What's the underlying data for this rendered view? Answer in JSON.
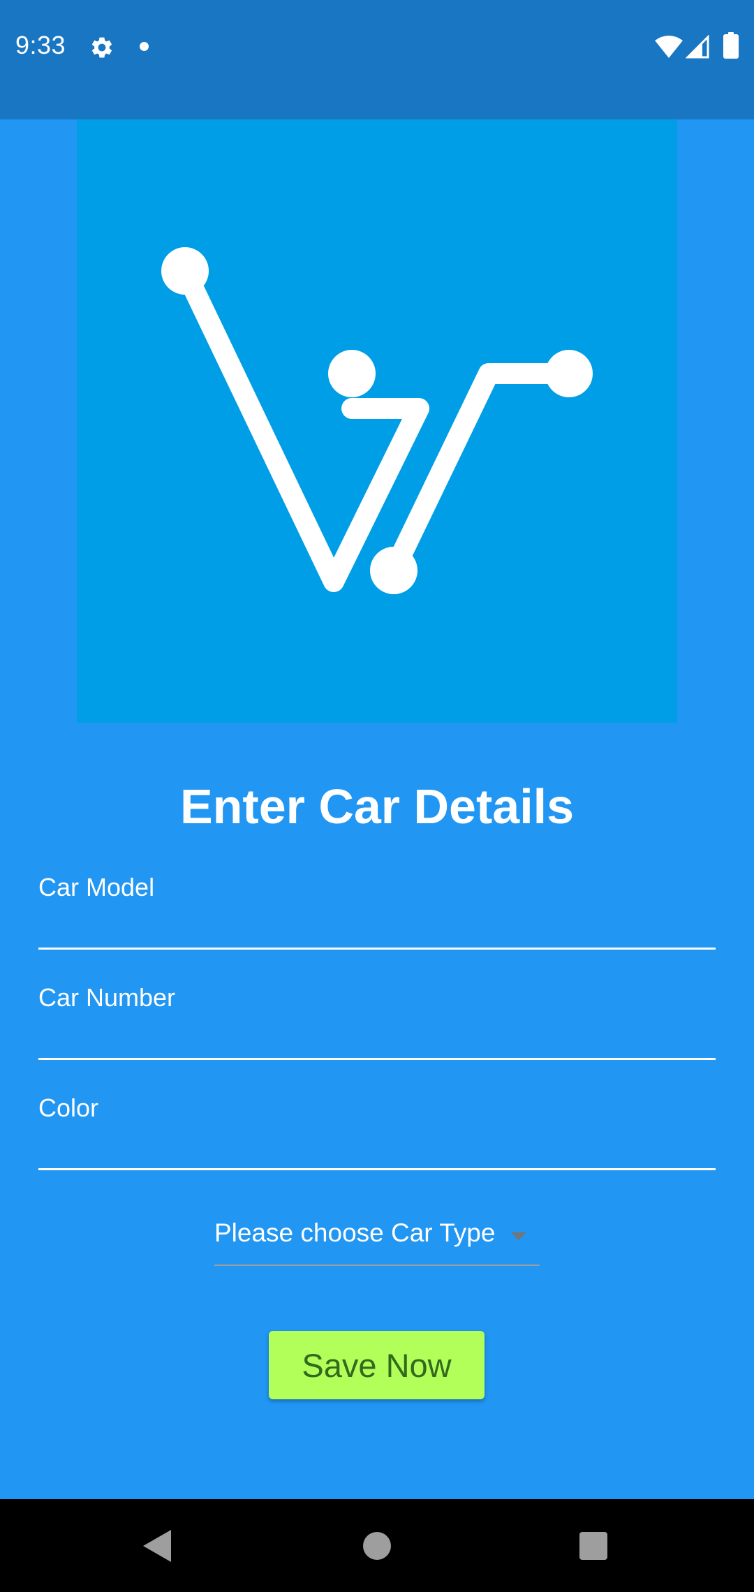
{
  "status_bar": {
    "time": "9:33",
    "icons": [
      "gear-icon",
      "notification-dot-icon",
      "wifi-icon",
      "signal-icon",
      "battery-icon"
    ]
  },
  "logo": {
    "icon": "vt-circuit-logo-icon",
    "background_color": "#009ee6"
  },
  "form": {
    "title": "Enter Car Details",
    "fields": [
      {
        "label": "Car Model",
        "value": ""
      },
      {
        "label": "Car Number",
        "value": ""
      },
      {
        "label": "Color",
        "value": ""
      }
    ],
    "car_type_dropdown": {
      "selected": "Please choose Car Type"
    },
    "save_label": "Save Now"
  },
  "nav_bar": {
    "icons": [
      "back-icon",
      "home-icon",
      "recents-icon"
    ]
  },
  "colors": {
    "background": "#2196f3",
    "status_bar": "#1976c2",
    "button": "#b2ff59",
    "button_text": "#33691e"
  }
}
